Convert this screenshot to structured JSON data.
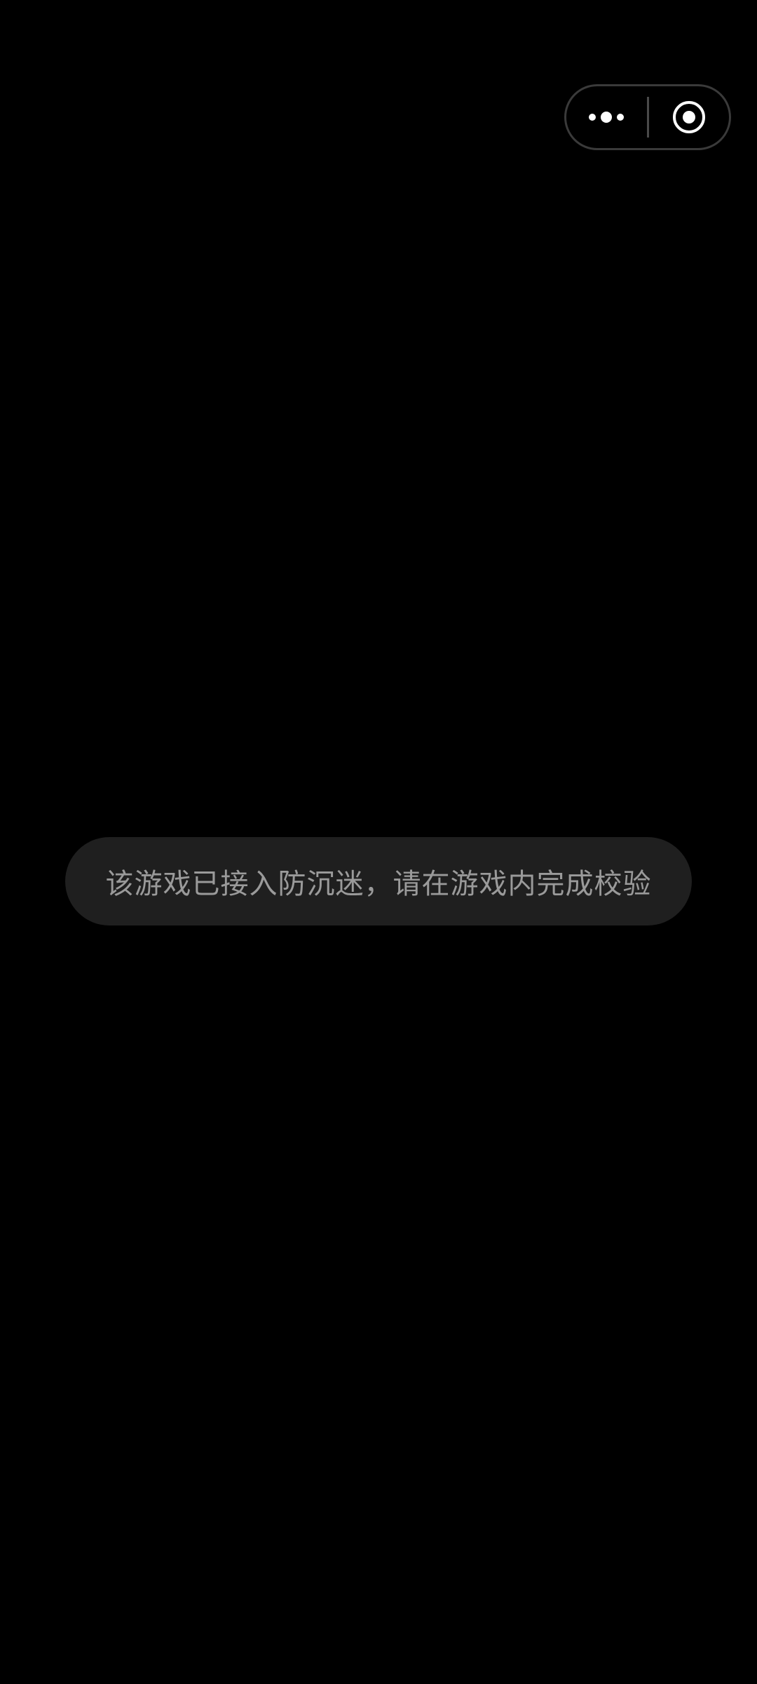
{
  "capsule": {
    "menu_icon": "more-dots-icon",
    "close_icon": "close-ring-icon"
  },
  "toast": {
    "message": "该游戏已接入防沉迷，请在游戏内完成校验"
  },
  "colors": {
    "background": "#000000",
    "toast_background": "#1f1f1f",
    "toast_text": "#9a9a9a",
    "capsule_border": "#3a3a3a",
    "icon": "#ffffff"
  }
}
